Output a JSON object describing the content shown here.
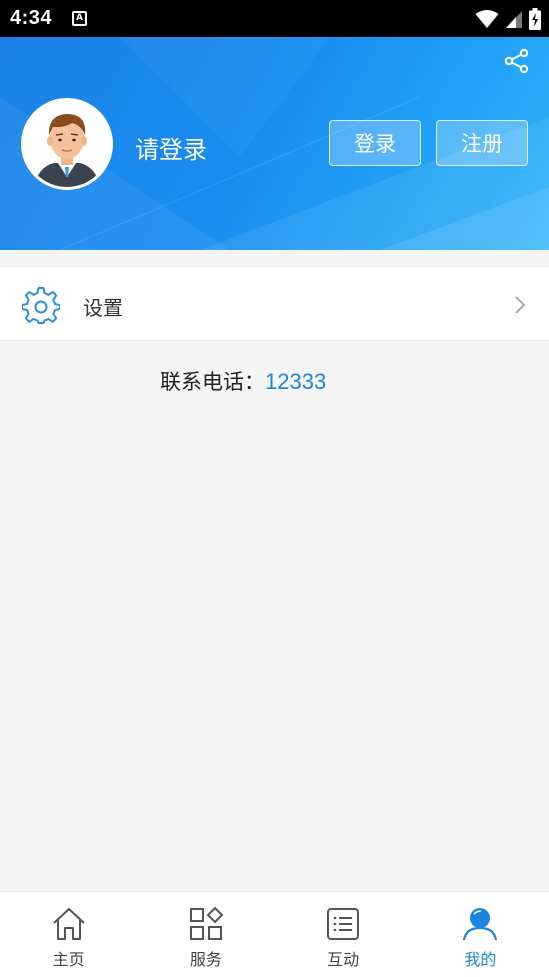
{
  "status_bar": {
    "time": "4:34",
    "a_badge": "A"
  },
  "header": {
    "login_prompt": "请登录",
    "login_button": "登录",
    "register_button": "注册"
  },
  "settings": {
    "label": "设置"
  },
  "contact": {
    "label": "联系电话：",
    "phone": "12333"
  },
  "tabs": [
    {
      "label": "主页",
      "icon": "home-icon",
      "active": false
    },
    {
      "label": "服务",
      "icon": "grid-icon",
      "active": false
    },
    {
      "label": "互动",
      "icon": "list-icon",
      "active": false
    },
    {
      "label": "我的",
      "icon": "profile-icon",
      "active": true
    }
  ],
  "colors": {
    "accent": "#1a86e0",
    "header_start": "#1a82e6",
    "header_end": "#2fb3fa"
  }
}
